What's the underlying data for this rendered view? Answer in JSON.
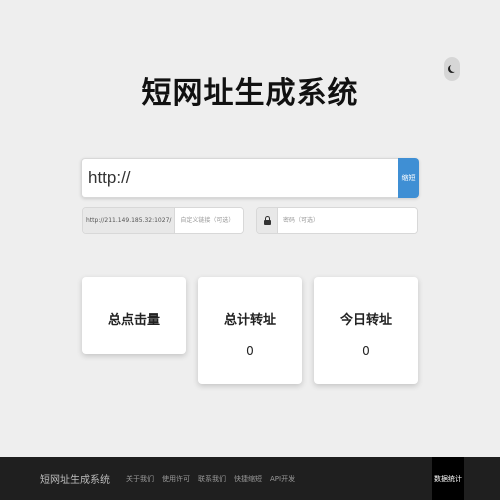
{
  "header": {
    "title": "短网址生成系统",
    "theme_toggle_icon": "moon-icon"
  },
  "url_form": {
    "url_value": "http://",
    "generate_label": "缩短",
    "domain_prefix": "http://211.149.185.32:1027/",
    "custom_suffix_placeholder": "自定义链接（可选）",
    "password_icon": "lock-icon",
    "password_placeholder": "密码（可选）"
  },
  "stats": [
    {
      "label": "总点击量",
      "value": ""
    },
    {
      "label": "总计转址",
      "value": "0"
    },
    {
      "label": "今日转址",
      "value": "0"
    }
  ],
  "footer": {
    "brand": "短网址生成系统",
    "links": [
      "关于我们",
      "使用许可",
      "联系我们",
      "快捷缩短",
      "API开发"
    ],
    "stats_label": "数据统计"
  },
  "colors": {
    "background": "#eeeeee",
    "accent": "#3f8fd4",
    "footer": "#1f1f1f"
  }
}
